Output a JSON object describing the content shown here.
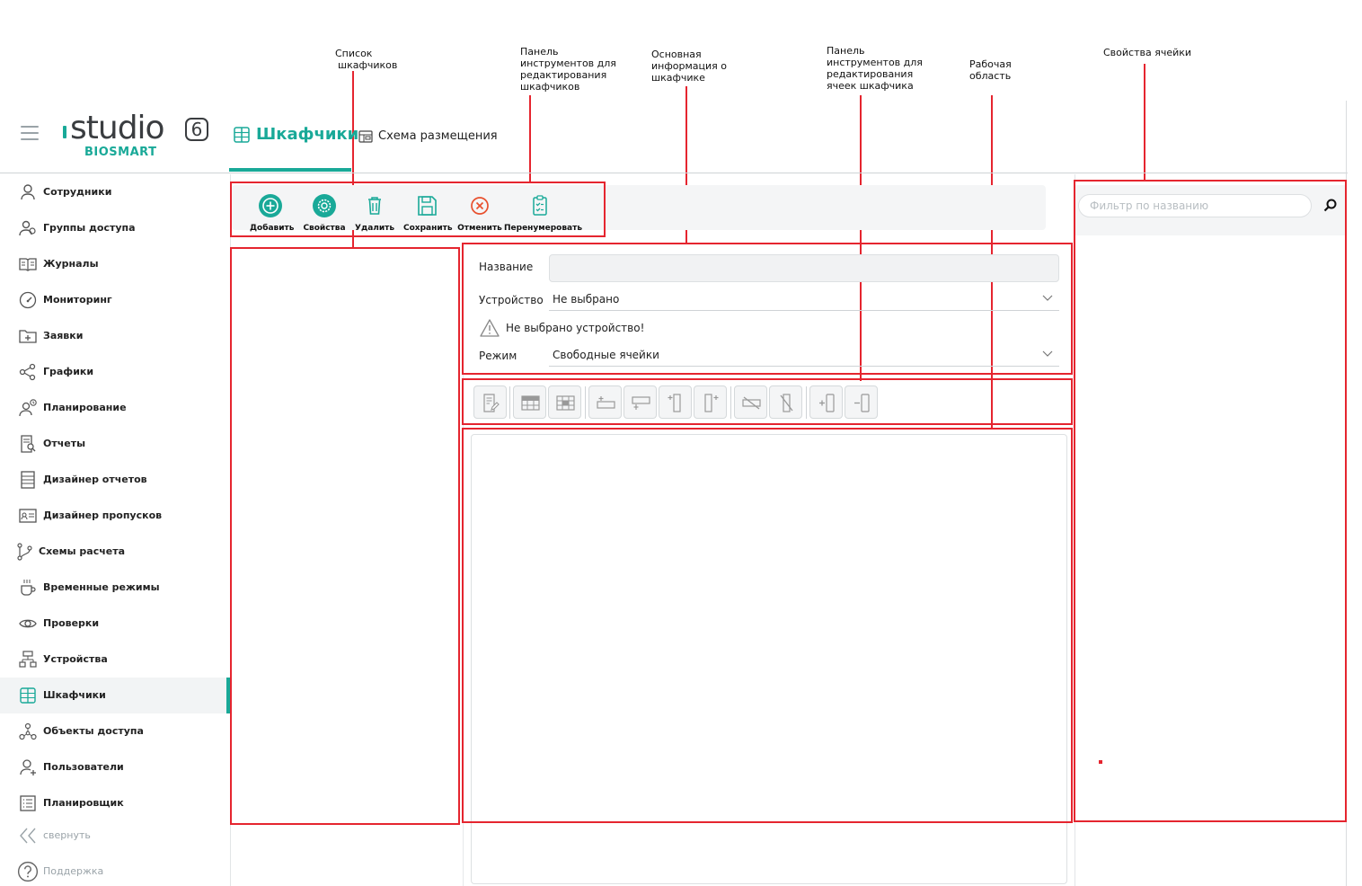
{
  "annotations": {
    "locker_list": [
      "Список",
      "шкафчиков"
    ],
    "locker_toolbar": [
      "Панель",
      "инструментов для",
      "редактирования",
      "шкафчиков"
    ],
    "locker_info": [
      "Основная",
      "информация о",
      "шкафчике"
    ],
    "cell_toolbar": [
      "Панель",
      "инструментов для",
      "редактирования",
      "ячеек шкафчика"
    ],
    "work_area": [
      "Рабочая",
      "область"
    ],
    "cell_props": [
      "Свойства ячейки"
    ]
  },
  "logo": {
    "word": "studio",
    "version": "6",
    "brand": "BIOSMART"
  },
  "tabs": [
    {
      "label": "Шкафчики",
      "active": true
    },
    {
      "label": "Схема размещения",
      "active": false
    }
  ],
  "sidebar": {
    "items": [
      {
        "label": "Сотрудники",
        "icon": "user-icon"
      },
      {
        "label": "Группы доступа",
        "icon": "group-icon"
      },
      {
        "label": "Журналы",
        "icon": "book-icon"
      },
      {
        "label": "Мониторинг",
        "icon": "gauge-icon"
      },
      {
        "label": "Заявки",
        "icon": "folder-plus-icon"
      },
      {
        "label": "Графики",
        "icon": "share-icon"
      },
      {
        "label": "Планирование",
        "icon": "user-clock-icon"
      },
      {
        "label": "Отчеты",
        "icon": "report-search-icon"
      },
      {
        "label": "Дизайнер отчетов",
        "icon": "report-designer-icon"
      },
      {
        "label": "Дизайнер пропусков",
        "icon": "id-card-icon"
      },
      {
        "label": "Схемы расчета",
        "icon": "branch-icon"
      },
      {
        "label": "Временные режимы",
        "icon": "cup-icon"
      },
      {
        "label": "Проверки",
        "icon": "eye-icon"
      },
      {
        "label": "Устройства",
        "icon": "network-icon"
      },
      {
        "label": "Шкафчики",
        "icon": "locker-icon",
        "active": true
      },
      {
        "label": "Объекты доступа",
        "icon": "nodes-icon"
      },
      {
        "label": "Пользователи",
        "icon": "user-plus-icon"
      },
      {
        "label": "Планировщик",
        "icon": "list-icon"
      }
    ],
    "collapse_label": "свернуть",
    "support_label": "Поддержка"
  },
  "toolbar": {
    "add": "Добавить",
    "properties": "Свойства",
    "delete": "Удалить",
    "save": "Сохранить",
    "cancel": "Отменить",
    "renumber": "Перенумеровать"
  },
  "form": {
    "name_label": "Название",
    "name_value": "",
    "device_label": "Устройство",
    "device_value": "Не выбрано",
    "warning": "Не выбрано устройство!",
    "mode_label": "Режим",
    "mode_value": "Свободные ячейки"
  },
  "cell_props": {
    "filter_placeholder": "Фильтр по названию"
  },
  "colors": {
    "accent": "#19a998",
    "annotation": "#e5252f",
    "danger": "#e8502e"
  }
}
